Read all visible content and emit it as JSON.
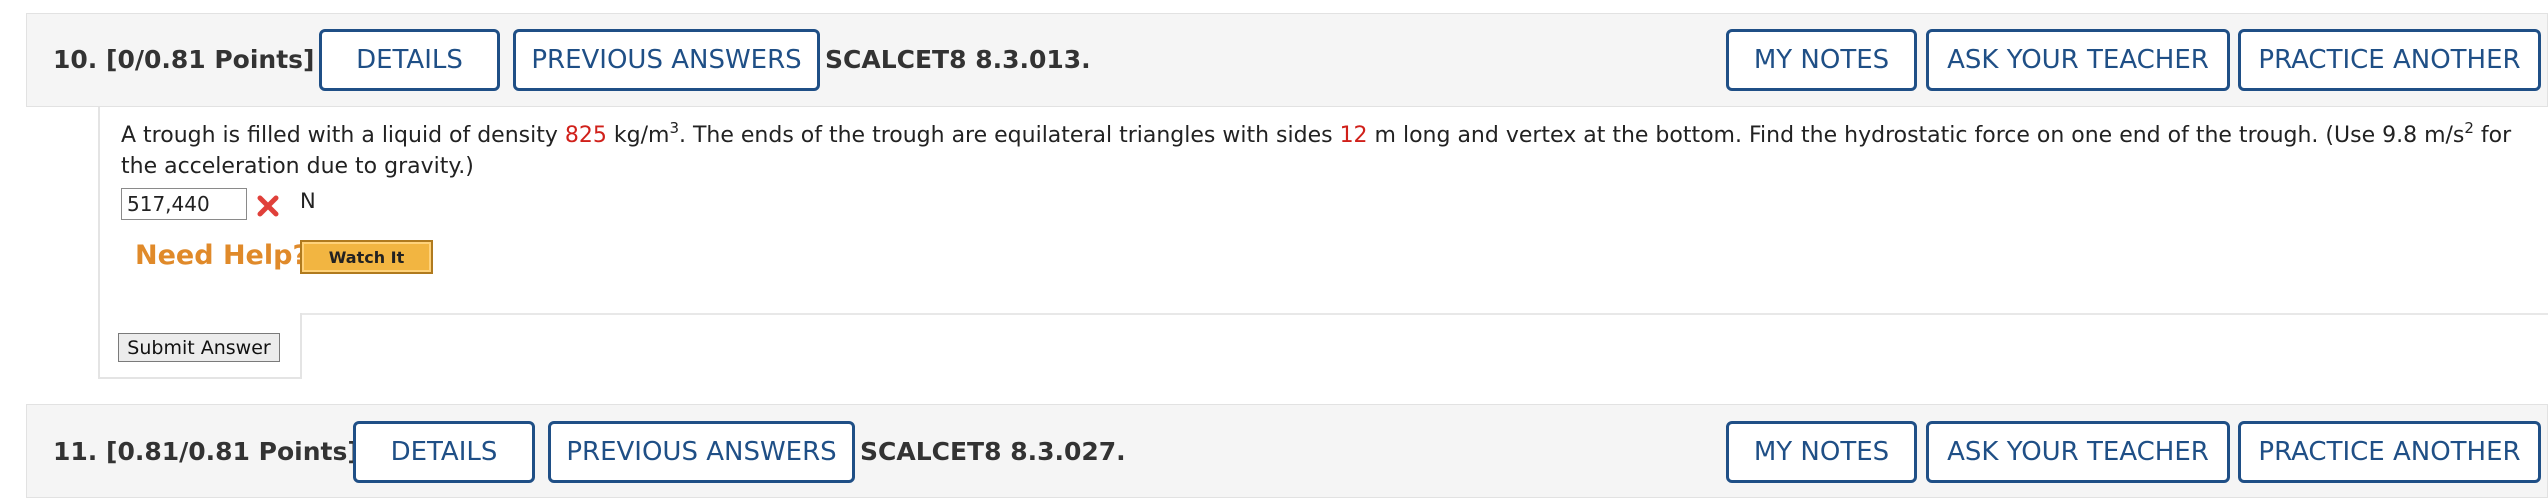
{
  "questions": [
    {
      "number": "10.",
      "points": "[0/0.81 Points]",
      "details_label": "DETAILS",
      "previous_answers_label": "PREVIOUS ANSWERS",
      "ref_code": "SCALCET8 8.3.013.",
      "my_notes_label": "MY NOTES",
      "ask_teacher_label": "ASK YOUR TEACHER",
      "practice_another_label": "PRACTICE ANOTHER"
    },
    {
      "number": "11.",
      "points": "[0.81/0.81 Points]",
      "details_label": "DETAILS",
      "previous_answers_label": "PREVIOUS ANSWERS",
      "ref_code": "SCALCET8 8.3.027.",
      "my_notes_label": "MY NOTES",
      "ask_teacher_label": "ASK YOUR TEACHER",
      "practice_another_label": "PRACTICE ANOTHER"
    }
  ],
  "problem": {
    "text_1": "A trough is filled with a liquid of density ",
    "density_value": "825",
    "density_unit": " kg/m",
    "density_exp": "3",
    "text_2": ". The ends of the trough are equilateral triangles with sides ",
    "side_value": "12",
    "text_3": " m long and vertex at the bottom. Find the hydrostatic force on one end of the trough. (Use 9.8 m/s",
    "gravity_exp": "2",
    "text_4": " for the acceleration due to gravity.)",
    "answer_value": "517,440",
    "answer_status_icon": "x-mark-icon",
    "answer_status_color": "#e0403a",
    "answer_unit": "N",
    "need_help_label": "Need Help?",
    "watch_it_label": "Watch It",
    "submit_label": "Submit Answer"
  },
  "colors": {
    "button_blue": "#1f4f86",
    "highlight_red": "#d0201a",
    "help_orange": "#e08a2a",
    "watch_button": "#f2b541"
  }
}
